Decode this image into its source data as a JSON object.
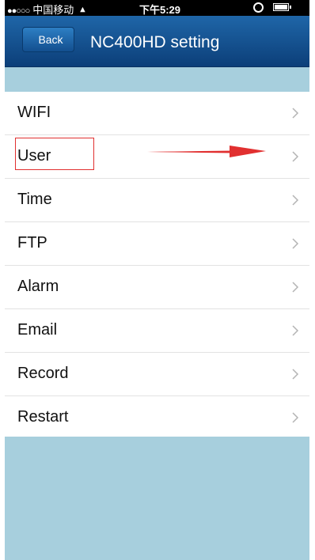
{
  "status_bar": {
    "signal_dots": "●●○○○",
    "carrier": "中国移动",
    "wifi_icon": "wifi-icon",
    "time": "下午5:29",
    "alarm_icon": "alarm-clock-icon",
    "battery_icon": "battery-icon"
  },
  "nav": {
    "back_label": "Back",
    "title": "NC400HD setting"
  },
  "menu": {
    "items": [
      {
        "label": "WIFI"
      },
      {
        "label": "User"
      },
      {
        "label": "Time"
      },
      {
        "label": "FTP"
      },
      {
        "label": "Alarm"
      },
      {
        "label": "Email"
      },
      {
        "label": "Record"
      },
      {
        "label": "Restart"
      }
    ],
    "chevron_icon": "chevron-right-icon"
  },
  "annotation": {
    "highlighted_item": "User",
    "highlight_color": "#e13030"
  },
  "colors": {
    "nav_bar": "#0c3f79",
    "background": "#a7cfdd"
  }
}
